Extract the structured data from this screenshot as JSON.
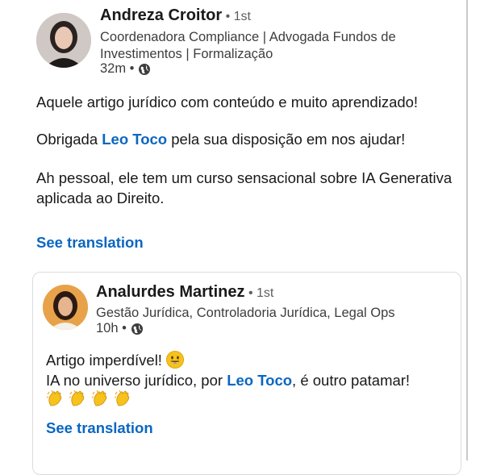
{
  "outer_post": {
    "author_name": "Andreza Croitor",
    "degree": "• 1st",
    "headline": "Coordenadora Compliance | Advogada Fundos de Investimentos | Formalização",
    "time": "32m •",
    "globe_icon": "globe-icon",
    "paragraph1": "Aquele artigo jurídico com conteúdo e muito aprendizado!",
    "paragraph2_before": "Obrigada ",
    "paragraph2_mention": "Leo Toco",
    "paragraph2_after": "  pela sua disposição em nos ajudar!",
    "paragraph3": "Ah pessoal, ele tem um curso sensacional sobre IA Generativa aplicada ao Direito.",
    "see_translation": "See translation"
  },
  "inner_post": {
    "author_name": "Analurdes Martinez",
    "degree": "• 1st",
    "headline": "Gestão Jurídica, Controladoria Jurídica, Legal Ops",
    "time": "10h •",
    "globe_icon": "globe-icon",
    "line1": "Artigo imperdível!",
    "line1_emoji": "smiling-face-emoji",
    "line2_before": "IA no universo jurídico, por ",
    "line2_mention": "Leo Toco",
    "line2_after": ", é outro patamar!",
    "clap_count": 4,
    "clap_emoji": "clapping-hands-emoji",
    "see_translation": "See translation"
  },
  "colors": {
    "link": "#0a66c2",
    "text": "#191919",
    "secondary": "#3d3d3d"
  }
}
